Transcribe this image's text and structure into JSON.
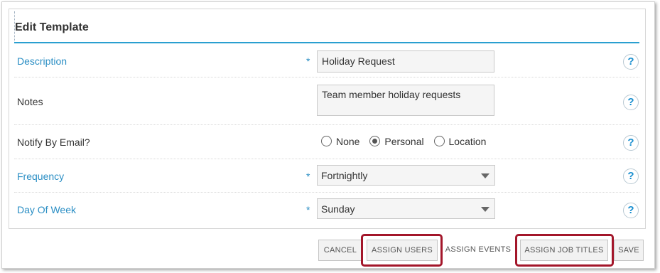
{
  "form": {
    "title": "Edit Template",
    "fields": {
      "description": {
        "label": "Description",
        "value": "Holiday Request"
      },
      "notes": {
        "label": "Notes",
        "value": "Team member holiday requests"
      },
      "notify": {
        "label": "Notify By Email?",
        "options": [
          "None",
          "Personal",
          "Location"
        ],
        "selected": "Personal"
      },
      "frequency": {
        "label": "Frequency",
        "value": "Fortnightly"
      },
      "day_of_week": {
        "label": "Day Of Week",
        "value": "Sunday"
      }
    },
    "required_marker": "*",
    "help_glyph": "?"
  },
  "buttons": {
    "cancel": "CANCEL",
    "assign_users": "ASSIGN USERS",
    "assign_events": "ASSIGN EVENTS",
    "assign_job_titles": "ASSIGN JOB TITLES",
    "save": "SAVE"
  },
  "colors": {
    "accent": "#2a9fd0",
    "highlight": "#a3162a"
  }
}
